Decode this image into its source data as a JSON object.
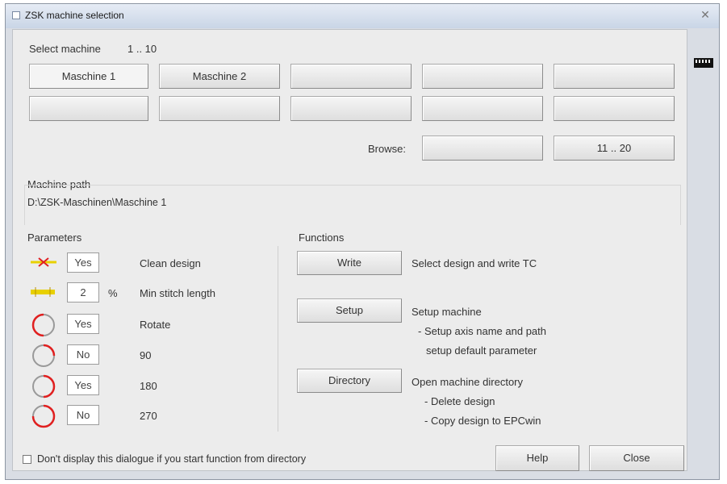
{
  "window": {
    "title": "ZSK machine selection",
    "close_glyph": "✕"
  },
  "select_machine": {
    "label": "Select machine",
    "range": "1 .. 10",
    "buttons": [
      "Maschine 1",
      "Maschine 2",
      "",
      "",
      "",
      "",
      "",
      "",
      "",
      ""
    ],
    "selected": "Maschine 1"
  },
  "browse": {
    "label": "Browse:",
    "left_button": "",
    "right_button": "11 .. 20"
  },
  "machine_path": {
    "label": "Machine path",
    "value": "D:\\ZSK-Maschinen\\Maschine 1"
  },
  "parameters": {
    "label": "Parameters",
    "rows": [
      {
        "icon": "clean-design-icon",
        "value": "Yes",
        "unit": "",
        "text": "Clean design"
      },
      {
        "icon": "min-stitch-icon",
        "value": "2",
        "unit": "%",
        "text": "Min stitch length"
      },
      {
        "icon": "rotate-icon",
        "value": "Yes",
        "unit": "",
        "text": "Rotate"
      },
      {
        "icon": "rotate-90-icon",
        "value": "No",
        "unit": "",
        "text": "90"
      },
      {
        "icon": "rotate-180-icon",
        "value": "Yes",
        "unit": "",
        "text": "180"
      },
      {
        "icon": "rotate-270-icon",
        "value": "No",
        "unit": "",
        "text": "270"
      }
    ]
  },
  "functions": {
    "label": "Functions",
    "write": {
      "button": "Write",
      "desc": "Select design and write TC"
    },
    "setup": {
      "button": "Setup",
      "desc_1": "Setup machine",
      "desc_2": "- Setup axis name and path",
      "desc_3": "setup default parameter"
    },
    "directory": {
      "button": "Directory",
      "desc_1": "Open machine directory",
      "desc_2": "- Delete design",
      "desc_3": "- Copy design to EPCwin"
    }
  },
  "footer": {
    "checkbox_label": "Don't display this dialogue if you start function from directory",
    "help_button": "Help",
    "close_button": "Close"
  },
  "colors": {
    "accent_red": "#e02020",
    "yellow": "#e8d000"
  }
}
